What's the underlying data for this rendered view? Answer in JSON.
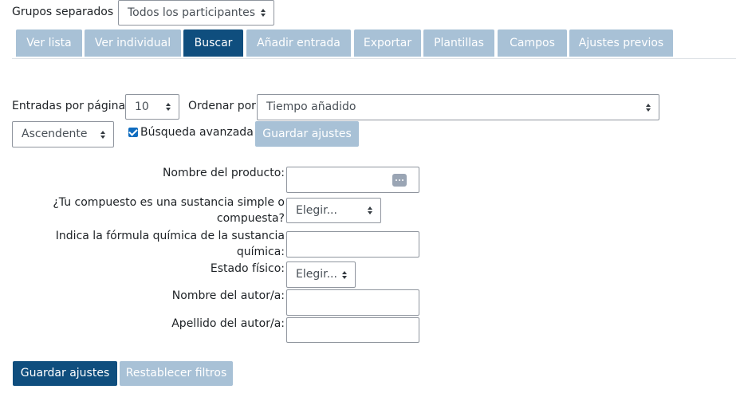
{
  "groups": {
    "label": "Grupos separados",
    "selected": "Todos los participantes"
  },
  "tabs": [
    {
      "label": "Ver lista",
      "active": false
    },
    {
      "label": "Ver individual",
      "active": false
    },
    {
      "label": "Buscar",
      "active": true
    },
    {
      "label": "Añadir entrada",
      "active": false
    },
    {
      "label": "Exportar",
      "active": false
    },
    {
      "label": "Plantillas",
      "active": false
    },
    {
      "label": "Campos",
      "active": false
    },
    {
      "label": "Ajustes previos",
      "active": false
    }
  ],
  "search_options": {
    "per_page_label": "Entradas por página",
    "per_page_value": "10",
    "sort_label": "Ordenar por",
    "sort_value": "Tiempo añadido",
    "order_value": "Ascendente",
    "advanced_label": "Búsqueda avanzada",
    "advanced_checked": true,
    "save_settings_label": "Guardar ajustes"
  },
  "fields": [
    {
      "label": "Nombre del producto:",
      "type": "text",
      "value": ""
    },
    {
      "label_line1": "¿Tu compuesto es una sustancia simple o",
      "label_line2": "compuesta?",
      "type": "select",
      "value": "Elegir..."
    },
    {
      "label_line1": "Indica la fórmula química de la sustancia",
      "label_line2": "química:",
      "type": "text",
      "value": ""
    },
    {
      "label": "Estado físico:",
      "type": "select",
      "value": "Elegir..."
    },
    {
      "label": "Nombre del autor/a:",
      "type": "text",
      "value": ""
    },
    {
      "label": "Apellido del autor/a:",
      "type": "text",
      "value": ""
    }
  ],
  "footer": {
    "save_label": "Guardar ajustes",
    "reset_label": "Restablecer filtros"
  },
  "colors": {
    "primary": "#0f4e7e",
    "tab_inactive": "#a8c1d6",
    "checkbox": "#0f6cbf"
  }
}
